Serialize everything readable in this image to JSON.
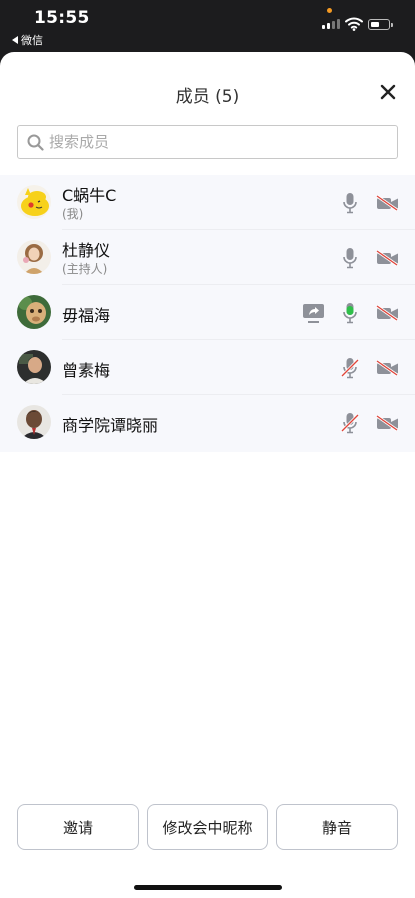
{
  "status_bar": {
    "time": "15:55",
    "back_label": "微信"
  },
  "header": {
    "title": "成员 (5)"
  },
  "search": {
    "placeholder": "搜索成员"
  },
  "members": [
    {
      "name": "C蜗牛C",
      "role": "(我)",
      "screen_share": false,
      "mic": "on",
      "video": "off"
    },
    {
      "name": "杜静仪",
      "role": "(主持人)",
      "screen_share": false,
      "mic": "on",
      "video": "off"
    },
    {
      "name": "毋福海",
      "role": "",
      "screen_share": true,
      "mic": "speaking",
      "video": "off"
    },
    {
      "name": "曾素梅",
      "role": "",
      "screen_share": false,
      "mic": "muted",
      "video": "off"
    },
    {
      "name": "商学院谭晓丽",
      "role": "",
      "screen_share": false,
      "mic": "muted",
      "video": "off"
    }
  ],
  "actions": {
    "invite": "邀请",
    "rename": "修改会中昵称",
    "mute": "静音"
  },
  "colors": {
    "mic_speaking": "#2fbf4a",
    "muted_slash": "#e0453b",
    "icon_gray": "#8e9199"
  }
}
